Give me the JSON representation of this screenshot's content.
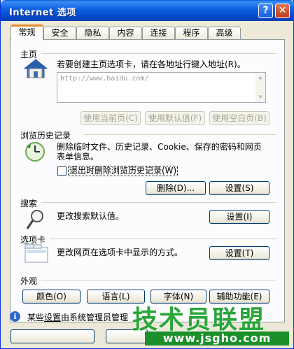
{
  "window": {
    "title": "Internet 选项",
    "help_label": "?",
    "close_label": "✕"
  },
  "tabs": [
    {
      "label": "常规",
      "active": true
    },
    {
      "label": "安全"
    },
    {
      "label": "隐私"
    },
    {
      "label": "内容"
    },
    {
      "label": "连接"
    },
    {
      "label": "程序"
    },
    {
      "label": "高级"
    }
  ],
  "home": {
    "title": "主页",
    "description": "若要创建主页选项卡，请在各地址行键入地址(R)。",
    "url_value": "http://www.baidu.com/",
    "icon": "home-icon",
    "buttons": [
      "使用当前页(C)",
      "使用默认值(F)",
      "使用空白页(B)"
    ]
  },
  "history": {
    "title": "浏览历史记录",
    "description_line1": "删除临时文件、历史记录、Cookie、保存的密码和网页",
    "description_line2": "表单信息。",
    "checkbox_label": "退出时删除浏览历史记录(W)",
    "checkbox_checked": false,
    "delete_label": "删除(D)...",
    "settings_label": "设置(S)",
    "icon": "clock-icon"
  },
  "search": {
    "title": "搜索",
    "description": "更改搜索默认值。",
    "settings_label": "设置(I)",
    "icon": "magnifier-icon"
  },
  "tabs_section": {
    "title": "选项卡",
    "description": "更改网页在选项卡中显示的方式。",
    "settings_label": "设置(T)",
    "icon": "tabs-icon"
  },
  "appearance": {
    "title": "外观",
    "buttons": [
      "颜色(O)",
      "语言(L)",
      "字体(N)",
      "辅助功能(E)"
    ]
  },
  "notice": {
    "prefix": "某些",
    "link": "设置",
    "suffix": "由系统管理员管理"
  },
  "watermark": {
    "brand": "技术员联盟",
    "url": "www.jsgho.com"
  },
  "colors": {
    "title_bar": "#0a5fd8",
    "tab_accent": "#e68b2c",
    "watermark": "#2aa63a"
  }
}
